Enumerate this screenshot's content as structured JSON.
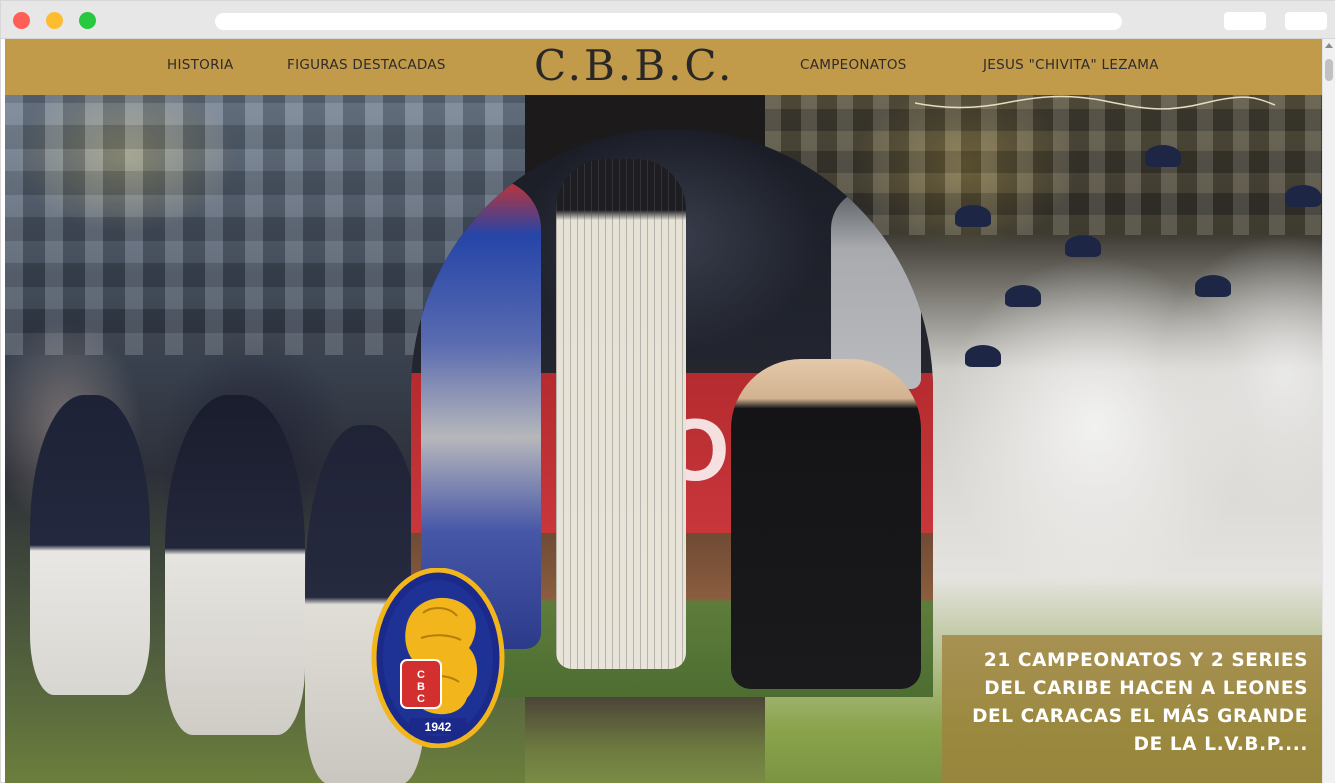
{
  "window": {
    "controls": [
      "close",
      "minimize",
      "maximize"
    ],
    "colors": {
      "close": "#fe5f57",
      "minimize": "#febc2e",
      "maximize": "#28c840"
    }
  },
  "nav": {
    "brand": "C.B.B.C.",
    "links": {
      "historia": "HISTORIA",
      "figuras": "FIGURAS DESTACADAS",
      "campeonatos": "CAMPEONATOS",
      "chivita": "JESUS \"CHIVITA\" LEZAMA"
    },
    "background_color": "#c19a4a"
  },
  "hero": {
    "center_banner_text": "OYO",
    "logo": {
      "letters": "CBC",
      "year": "1942",
      "colors": {
        "ring": "#1b2a8a",
        "lion": "#f2b61c",
        "shield": "#d32f2f"
      }
    },
    "caption": {
      "lines": [
        "21 CAMPEONATOS Y 2 SERIES",
        "DEL CARIBE HACEN A LEONES",
        "DEL CARACAS EL MÁS GRANDE",
        "DE LA L.V.B.P...."
      ]
    }
  }
}
